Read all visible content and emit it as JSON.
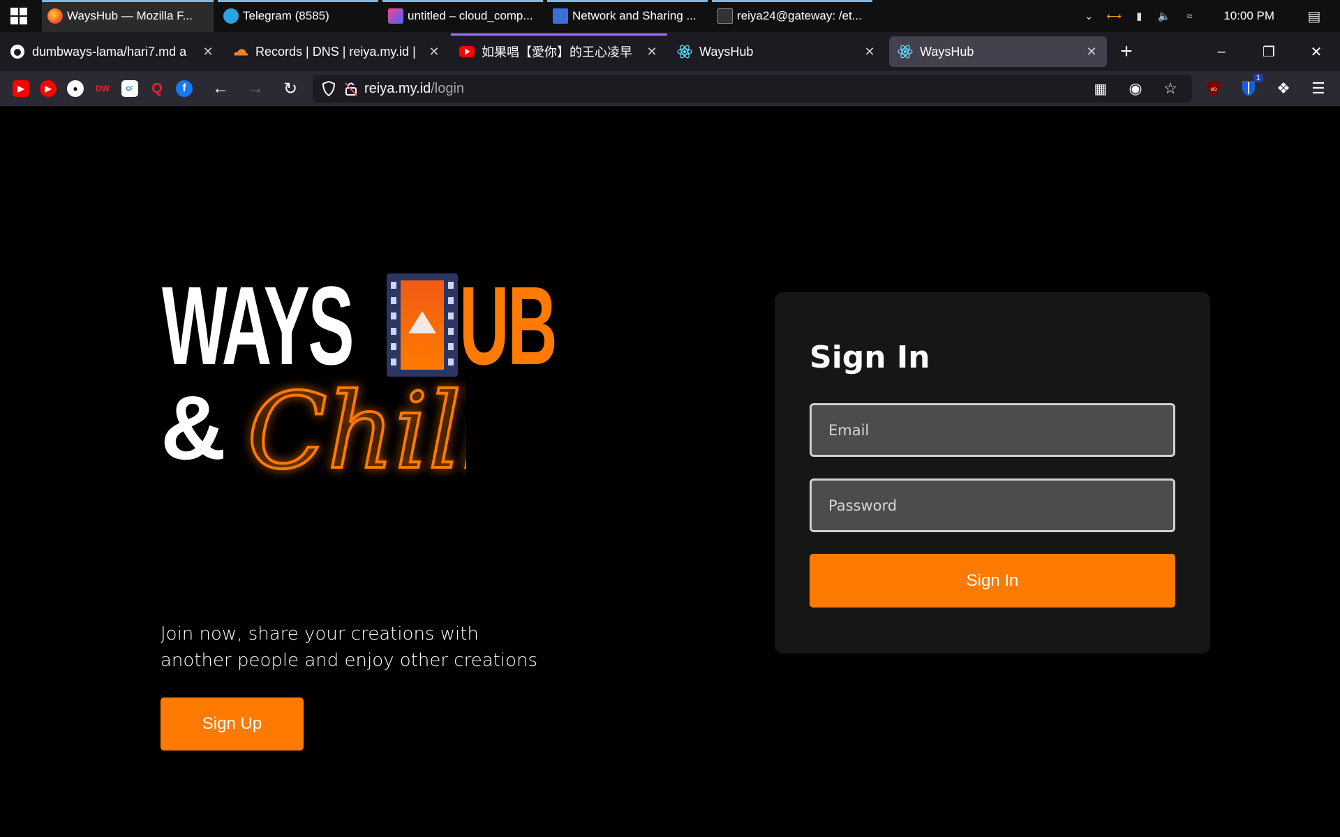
{
  "taskbar": {
    "apps": [
      {
        "label": "WaysHub — Mozilla F...",
        "icon": "firefox-icon",
        "active": true
      },
      {
        "label": "Telegram (8585)",
        "icon": "telegram-icon"
      },
      {
        "label": "untitled – cloud_comp...",
        "icon": "ide-icon"
      },
      {
        "label": "Network and Sharing ...",
        "icon": "network-icon"
      },
      {
        "label": "reiya24@gateway: /et...",
        "icon": "terminal-icon"
      }
    ],
    "clock": "10:00 PM"
  },
  "tabs": [
    {
      "label": "dumbways-lama/hari7.md a",
      "icon": "github-icon"
    },
    {
      "label": "Records | DNS | reiya.my.id |",
      "icon": "cloudflare-icon"
    },
    {
      "label": "如果唱【愛你】的王心凌早",
      "icon": "youtube-icon"
    },
    {
      "label": "WaysHub",
      "icon": "react-icon"
    },
    {
      "label": "WaysHub",
      "icon": "react-icon"
    }
  ],
  "urlbar": {
    "host": "reiya.my.id",
    "path": "/login"
  },
  "extensions": {
    "bitwarden_badge": "1"
  },
  "hero": {
    "tagline": "Join now, share your creations with another people and enjoy other creations",
    "signup_label": "Sign Up"
  },
  "logo": {
    "ways": "WAYS",
    "ub": "UB",
    "amp": "&",
    "chill": "Chill"
  },
  "signin": {
    "title": "Sign In",
    "email_placeholder": "Email",
    "password_placeholder": "Password",
    "button_label": "Sign In"
  },
  "colors": {
    "accent": "#ff7a00",
    "card": "#161616",
    "field": "#4c4c4c"
  }
}
